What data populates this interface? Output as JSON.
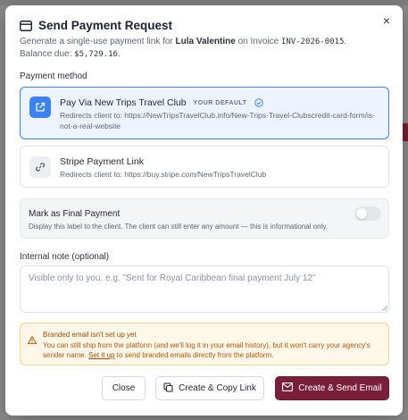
{
  "dialog": {
    "title": "Send Payment Request",
    "close_glyph": "×",
    "subtitle": {
      "prefix": "Generate a single-use payment link for ",
      "client_name": "Lula Valentine",
      "middle": " on Invoice ",
      "invoice_number": "INV-2026-0015",
      "balance_prefix": ". Balance due: ",
      "balance_due": "$5,729.16",
      "suffix": "."
    }
  },
  "payment_method": {
    "label": "Payment method",
    "options": [
      {
        "title": "Pay Via New Trips Travel Club",
        "badge": "YOUR DEFAULT",
        "description": "Redirects client to: https://NewTripsTravelClub.info/New-Trips-Travel-Clubscredit-card-form/is-not-a-real-website",
        "selected": true,
        "icon": "external-link-icon"
      },
      {
        "title": "Stripe Payment Link",
        "badge": "",
        "description": "Redirects client to: https://buy.stripe.com/NewTripsTravelClub",
        "selected": false,
        "icon": "link-icon"
      }
    ]
  },
  "final_payment": {
    "title": "Mark as Final Payment",
    "description": "Display this label to the client. The client can still enter any amount — this is informational only.",
    "enabled": false
  },
  "internal_note": {
    "label": "Internal note (optional)",
    "placeholder": "Visible only to you. e.g. \"Sent for Royal Caribbean final payment July 12\"",
    "value": ""
  },
  "warning": {
    "title": "Branded email isn't set up yet",
    "body_before_link": "You can still ship from the platform (and we'll log it in your email history), but it won't carry your agency's sender name. ",
    "link_text": "Set it up",
    "body_after_link": " to send branded emails directly from the platform."
  },
  "actions": {
    "close_label": "Close",
    "copy_label": "Create & Copy Link",
    "send_label": "Create & Send Email"
  },
  "colors": {
    "primary_blue": "#3b82f6",
    "send_button": "#7a1f3b",
    "warning_bg": "#fff8e8",
    "warning_text": "#b45309"
  }
}
